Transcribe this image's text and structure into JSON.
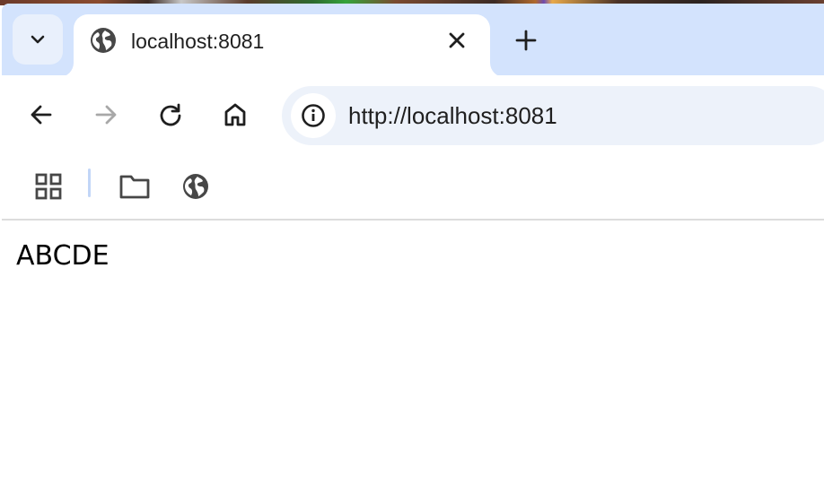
{
  "browser": {
    "tab": {
      "title": "localhost:8081",
      "favicon": "globe-icon"
    },
    "address_bar": {
      "url": "http://localhost:8081",
      "site_info_icon": "info-icon"
    },
    "bookmarks": [
      {
        "icon": "apps-grid-icon"
      },
      {
        "icon": "folder-icon"
      },
      {
        "icon": "globe-icon"
      }
    ]
  },
  "page": {
    "body_text": "ABCDE"
  },
  "colors": {
    "tabstrip": "#d3e3fd",
    "omnibox": "#edf2fa",
    "icon": "#474747"
  }
}
